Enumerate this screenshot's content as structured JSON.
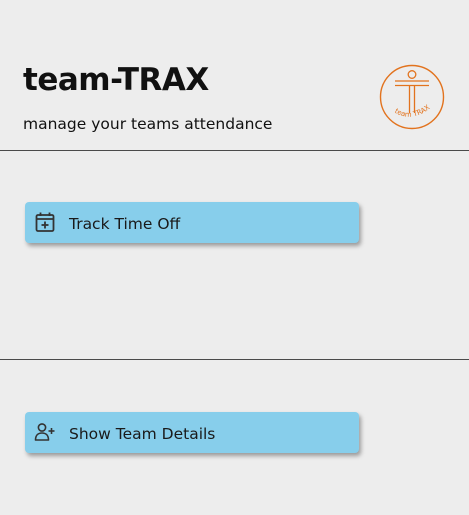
{
  "header": {
    "title": "team-TRAX",
    "subtitle": "manage your teams attendance",
    "logo": {
      "text": "team TRAX",
      "color": "#e2731e"
    }
  },
  "actions": [
    {
      "label": "Track Time Off",
      "icon": "calendar-plus-icon"
    },
    {
      "label": "Show Team Details",
      "icon": "person-add-icon"
    }
  ],
  "colors": {
    "background": "#ededed",
    "button": "#87ceeb",
    "accent": "#e2731e",
    "divider": "#4a4a4a"
  }
}
